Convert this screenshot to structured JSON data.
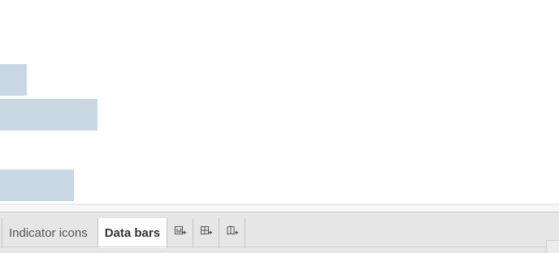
{
  "canvas": {
    "bars": [
      {
        "name": "bar-1",
        "fill_fraction": 0.048
      },
      {
        "name": "bar-2",
        "fill_fraction": 0.174
      },
      {
        "name": "bar-3",
        "fill_fraction": 0.132
      }
    ],
    "bar_color": "#c9d7e4"
  },
  "tabs": {
    "items": [
      {
        "label": "Indicator icons",
        "active": false
      },
      {
        "label": "Data bars",
        "active": true
      }
    ],
    "actions": [
      {
        "icon": "new-worksheet-icon"
      },
      {
        "icon": "new-dashboard-icon"
      },
      {
        "icon": "new-story-icon"
      }
    ]
  }
}
